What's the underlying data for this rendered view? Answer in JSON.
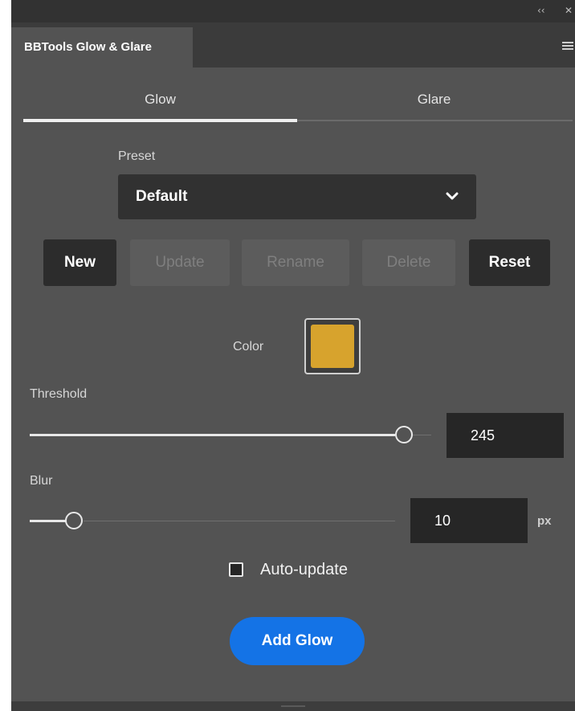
{
  "window": {
    "collapse_glyph": "‹‹",
    "close_glyph": "✕",
    "panel_tab": "BBTools Glow & Glare"
  },
  "tabs": [
    {
      "label": "Glow",
      "active": true
    },
    {
      "label": "Glare",
      "active": false
    }
  ],
  "preset": {
    "label": "Preset",
    "selected": "Default"
  },
  "buttons": {
    "new": "New",
    "update": "Update",
    "rename": "Rename",
    "delete": "Delete",
    "reset": "Reset"
  },
  "color": {
    "label": "Color",
    "value": "#d7a32d"
  },
  "threshold": {
    "label": "Threshold",
    "value": "245",
    "slider_fraction": 0.93
  },
  "blur": {
    "label": "Blur",
    "value": "10",
    "unit": "px",
    "slider_fraction": 0.09
  },
  "auto_update": {
    "label": "Auto-update",
    "checked": false
  },
  "primary_button": "Add Glow",
  "icons": {
    "collapse": "double-chevron-left-icon",
    "close": "close-icon",
    "menu": "hamburger-menu-icon",
    "dropdown": "chevron-down-icon"
  },
  "colors": {
    "accent": "#1473e6",
    "panel_bg": "#535353",
    "field_bg": "#262626"
  }
}
